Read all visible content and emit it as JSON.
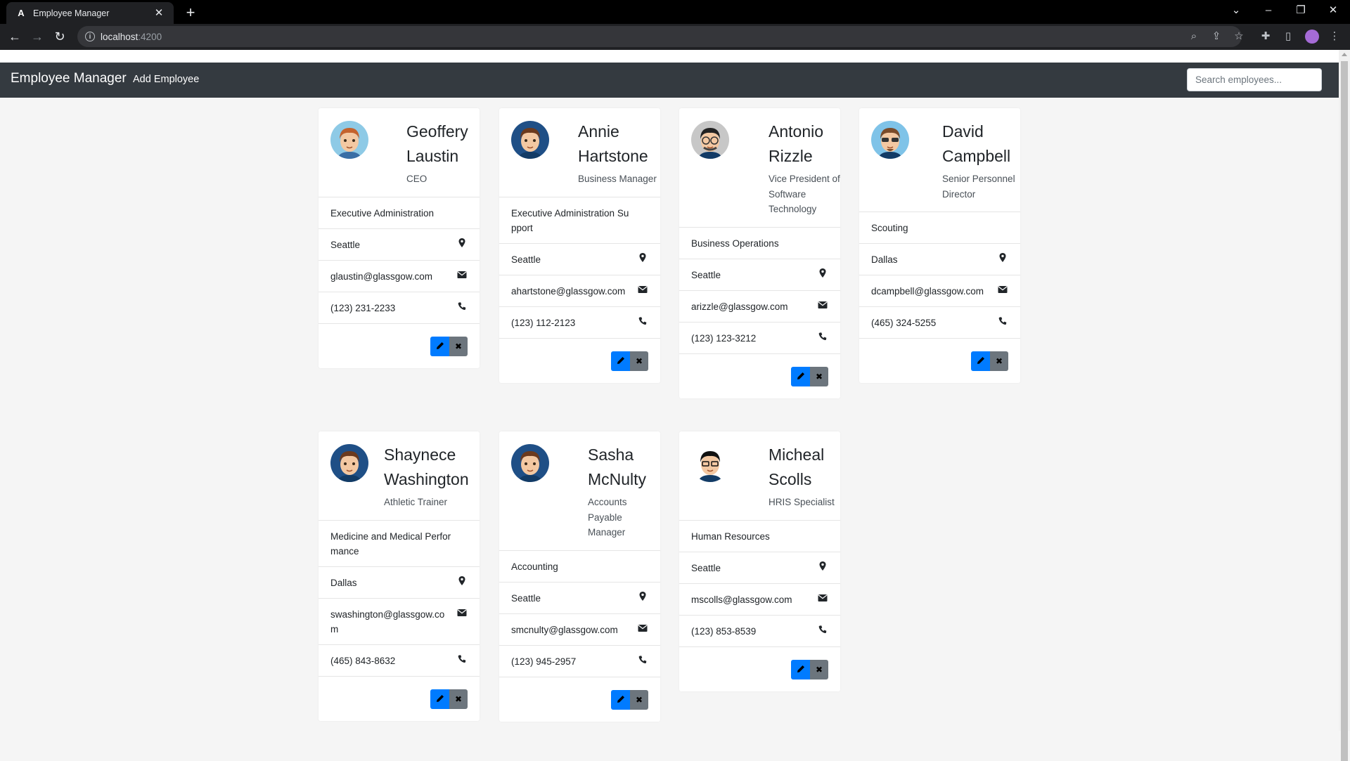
{
  "browser": {
    "tab_title": "Employee Manager",
    "favicon_letter": "A",
    "url_host": "localhost",
    "url_port": ":4200"
  },
  "nav": {
    "brand": "Employee Manager",
    "add_link": "Add Employee",
    "search_placeholder": "Search employees..."
  },
  "colors": {
    "navbar": "#343a40",
    "edit_button": "#007bff",
    "delete_button": "#6c757d"
  },
  "employees": [
    {
      "first": "Geoffery",
      "last": "Laustin",
      "title": "CEO",
      "department": "Executive Administration",
      "location": "Seattle",
      "email": "glaustin@glassgow.com",
      "phone": "(123) 231-2233",
      "avatar": "avatar-red-hair"
    },
    {
      "first": "Annie",
      "last": "Hartstone",
      "title": "Business Manager",
      "department": "Executive Administration Support",
      "location": "Seattle",
      "email": "ahartstone@glassgow.com",
      "phone": "(123) 112-2123",
      "avatar": "avatar-brown-hair"
    },
    {
      "first": "Antonio",
      "last": "Rizzle",
      "title": "Vice President of Software Technology",
      "department": "Business Operations",
      "location": "Seattle",
      "email": "arizzle@glassgow.com",
      "phone": "(123) 123-3212",
      "avatar": "avatar-glasses"
    },
    {
      "first": "David",
      "last": "Campbell",
      "title": "Senior Personnel Director",
      "department": "Scouting",
      "location": "Dallas",
      "email": "dcampbell@glassgow.com",
      "phone": "(465) 324-5255",
      "avatar": "avatar-sunglasses"
    },
    {
      "first": "Shaynece",
      "last": "Washington",
      "title": "Athletic Trainer",
      "department": "Medicine and Medical Performance",
      "location": "Dallas",
      "email": "swashington@glassgow.com",
      "phone": "(465) 843-8632",
      "avatar": "avatar-brown-hair"
    },
    {
      "first": "Sasha",
      "last": "McNulty",
      "title": "Accounts Payable Manager",
      "department": "Accounting",
      "location": "Seattle",
      "email": "smcnulty@glassgow.com",
      "phone": "(123) 945-2957",
      "avatar": "avatar-brown-hair"
    },
    {
      "first": "Micheal",
      "last": "Scolls",
      "title": "HRIS Specialist",
      "department": "Human Resources",
      "location": "Seattle",
      "email": "mscolls@glassgow.com",
      "phone": "(123) 853-8539",
      "avatar": "avatar-dark-glasses"
    }
  ]
}
